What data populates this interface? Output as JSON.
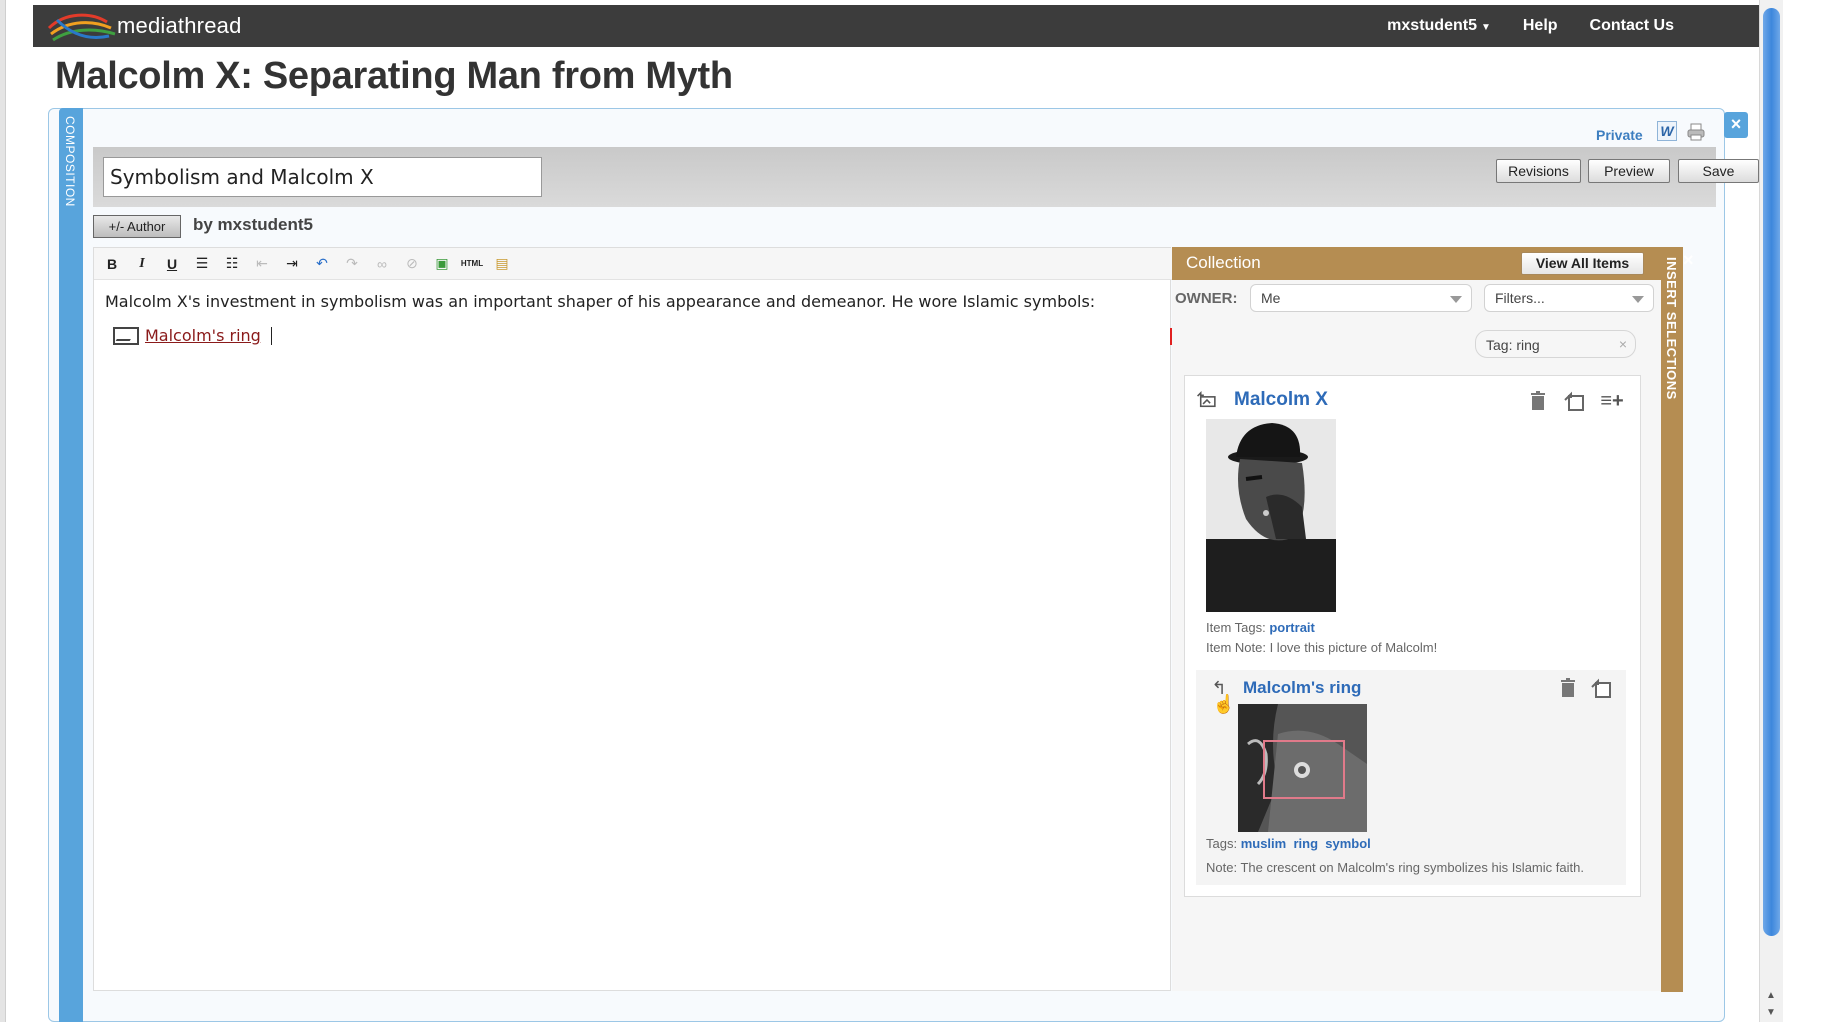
{
  "app": {
    "brand": "mediathread"
  },
  "topnav": {
    "user": "mxstudent5",
    "help": "Help",
    "contact": "Contact Us"
  },
  "page": {
    "title": "Malcolm X: Separating Man from Myth"
  },
  "composition": {
    "tab_label": "COMPOSITION",
    "visibility": "Private",
    "title_value": "Symbolism and Malcolm X",
    "revisions_label": "Revisions",
    "preview_label": "Preview",
    "save_label": "Save",
    "author_button": "+/- Author",
    "byline": "by mxstudent5",
    "body_text": "Malcolm X's investment in symbolism was an important shaper of his appearance and demeanor.  He wore Islamic symbols:",
    "citation_link": "Malcolm's ring"
  },
  "toolbar": {
    "bold": "B",
    "italic": "I",
    "underline": "U",
    "html": "HTML"
  },
  "collection": {
    "header": "Collection",
    "view_all": "View All Items",
    "owner_label": "OWNER:",
    "owner_value": "Me",
    "filters_placeholder": "Filters...",
    "tag_filter": "Tag: ring",
    "tag_clear": "×",
    "sidebar_label": "INSERT SELECTIONS",
    "close": "×",
    "items": [
      {
        "title": "Malcolm X",
        "tags_label": "Item Tags:",
        "tags": [
          "portrait"
        ],
        "note": "Item Note: I love this picture of Malcolm!"
      },
      {
        "title": "Malcolm's ring",
        "tags_label": "Tags:",
        "tags": [
          "muslim",
          "ring",
          "symbol"
        ],
        "note": "Note: The crescent on Malcolm's ring symbolizes his Islamic faith."
      }
    ]
  },
  "icons": [
    "logo-swoosh-icon",
    "caret-down-icon",
    "word-doc-icon",
    "print-icon",
    "close-icon",
    "image-icon",
    "trash-icon",
    "annotate-icon",
    "add-to-list-icon",
    "cite-back-icon",
    "cursor-hand-icon"
  ],
  "colors": {
    "accent_blue": "#58a4dc",
    "collection_tan": "#b58d52",
    "topbar": "#3c3c3c",
    "link_blue": "#2e6bb8"
  }
}
